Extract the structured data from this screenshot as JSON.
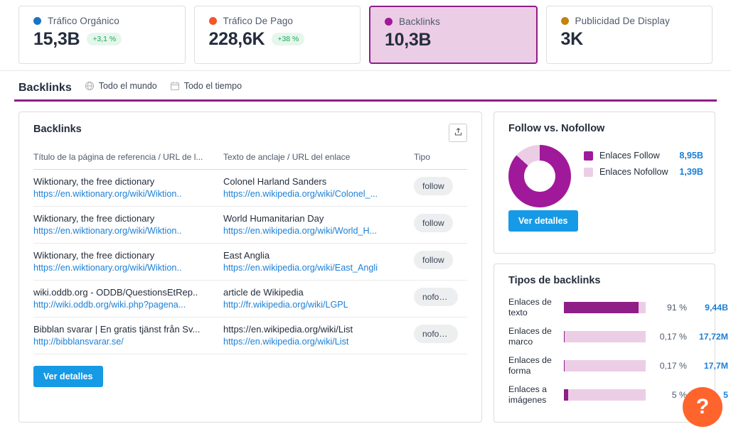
{
  "kpi_cards": [
    {
      "label": "Tráfico Orgánico",
      "value": "15,3B",
      "delta": "+3,1 %",
      "dot_color": "#1a73c4",
      "selected": false
    },
    {
      "label": "Tráfico De Pago",
      "value": "228,6K",
      "delta": "+38 %",
      "dot_color": "#f4542a",
      "selected": false
    },
    {
      "label": "Backlinks",
      "value": "10,3B",
      "delta": "",
      "dot_color": "#a0199a",
      "selected": true
    },
    {
      "label": "Publicidad De Display",
      "value": "3K",
      "delta": "",
      "dot_color": "#c4820e",
      "selected": false
    }
  ],
  "section": {
    "title": "Backlinks",
    "filters": [
      {
        "label": "Todo el mundo",
        "icon": "globe-icon"
      },
      {
        "label": "Todo el tiempo",
        "icon": "calendar-icon"
      }
    ],
    "rule_color": "#8f1e86"
  },
  "backlinks_panel": {
    "title": "Backlinks",
    "export_icon": "export-upload-icon",
    "columns": [
      "Título de la página de referencia / URL de l...",
      "Texto de anclaje / URL del enlace",
      "Tipo"
    ],
    "rows": [
      {
        "ref_title": "Wiktionary, the free dictionary",
        "ref_url": "https://en.wiktionary.org/wiki/Wiktion..",
        "anchor_text": "Colonel Harland Sanders",
        "anchor_url": "https://en.wikipedia.org/wiki/Colonel_...",
        "type": "follow"
      },
      {
        "ref_title": "Wiktionary, the free dictionary",
        "ref_url": "https://en.wiktionary.org/wiki/Wiktion..",
        "anchor_text": "World Humanitarian Day",
        "anchor_url": "https://en.wikipedia.org/wiki/World_H...",
        "type": "follow"
      },
      {
        "ref_title": "Wiktionary, the free dictionary",
        "ref_url": "https://en.wiktionary.org/wiki/Wiktion..",
        "anchor_text": "East Anglia",
        "anchor_url": "https://en.wikipedia.org/wiki/East_Angli",
        "type": "follow"
      },
      {
        "ref_title": "wiki.oddb.org - ODDB/QuestionsEtRep..",
        "ref_url": "http://wiki.oddb.org/wiki.php?pagena...",
        "anchor_text": "article de Wikipedia",
        "anchor_url": "http://fr.wikipedia.org/wiki/LGPL",
        "type": "nofoll..."
      },
      {
        "ref_title": "Bibblan svarar | En gratis tjänst från Sv...",
        "ref_url": "http://bibblansvarar.se/",
        "anchor_text": "https://en.wikipedia.org/wiki/List",
        "anchor_url": "https://en.wikipedia.org/wiki/List",
        "type": "nofoll..."
      }
    ],
    "details_button": "Ver detalles"
  },
  "follow_panel": {
    "title": "Follow vs. Nofollow",
    "details_button": "Ver detalles",
    "chart_data": {
      "type": "pie",
      "title": "Follow vs. Nofollow",
      "labels": [
        "Enlaces Follow",
        "Enlaces Nofollow"
      ],
      "values": [
        8.95,
        1.39
      ],
      "value_labels": [
        "8,95B",
        "1,39B"
      ],
      "percentages": [
        86.6,
        13.4
      ],
      "colors": [
        "#a0199a",
        "#eccde6"
      ],
      "legend": "right",
      "donut": true
    }
  },
  "types_panel": {
    "title": "Tipos de backlinks",
    "chart_data": {
      "type": "bar",
      "title": "Tipos de backlinks",
      "orientation": "horizontal",
      "categories": [
        "Enlaces de texto",
        "Enlaces de marco",
        "Enlaces de forma",
        "Enlaces a imágenes"
      ],
      "percent_labels": [
        "91 %",
        "0,17 %",
        "0,17 %",
        "5 %"
      ],
      "values": [
        91,
        0.17,
        0.17,
        5
      ],
      "value_labels": [
        "9,44B",
        "17,72M",
        "17,7M",
        "5"
      ],
      "bar_fill_percent": [
        91,
        0.17,
        0.17,
        5
      ],
      "track_color": "#eccde6",
      "fill_color": "#8f1e86",
      "xlim": [
        0,
        100
      ]
    }
  },
  "help_button": {
    "label": "?",
    "color": "#ff642d"
  }
}
